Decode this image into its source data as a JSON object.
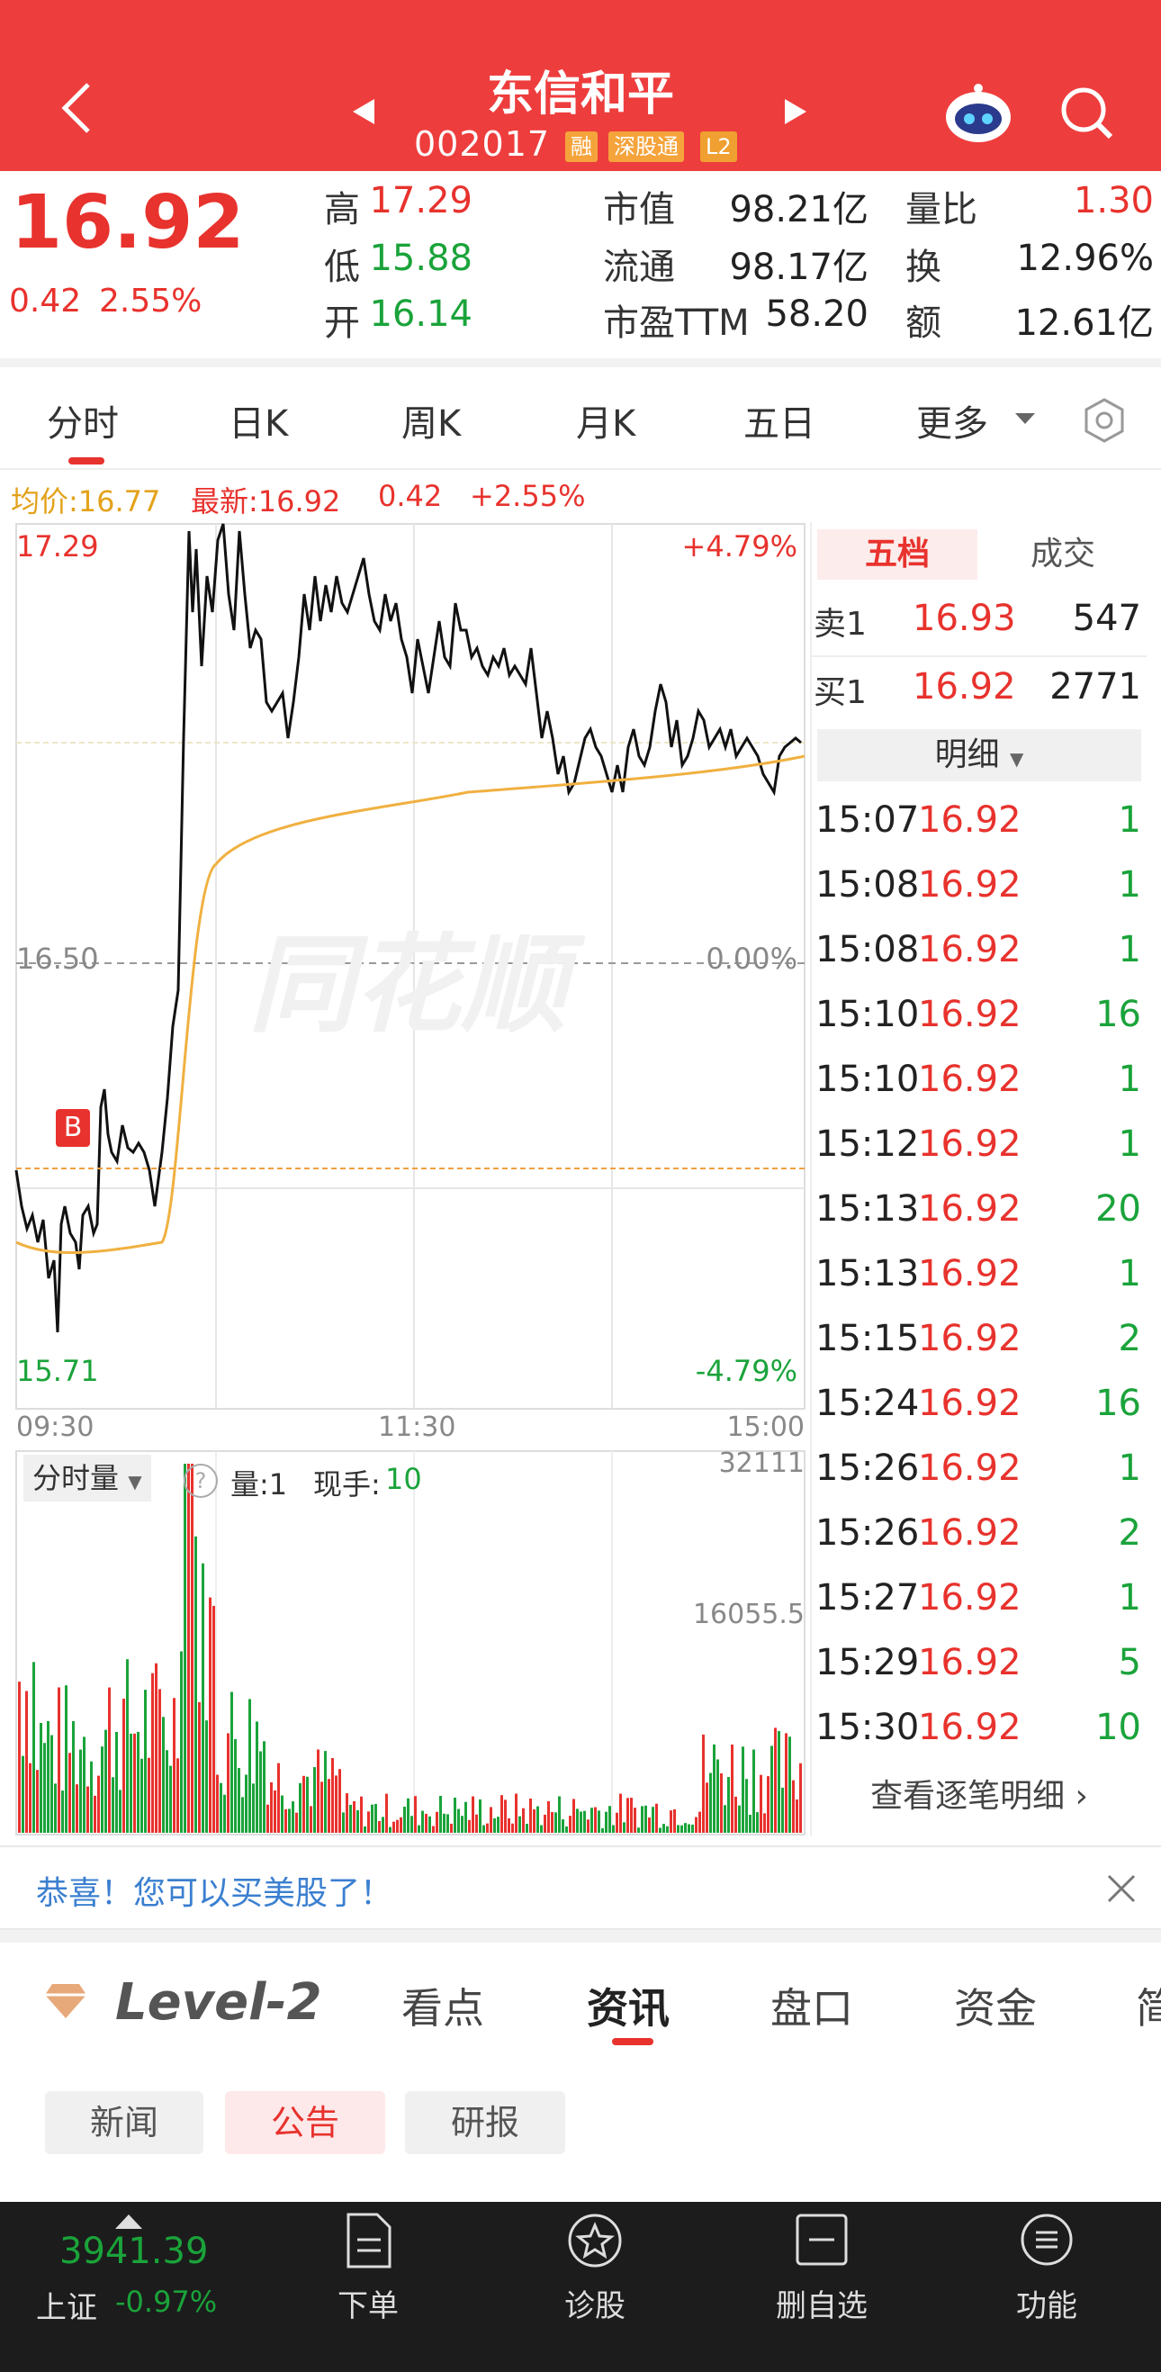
{
  "header": {
    "stock_name": "东信和平",
    "stock_code": "002017",
    "tags": [
      "融",
      "深股通",
      "L2"
    ]
  },
  "quote": {
    "price": "16.92",
    "change": "0.42",
    "change_pct": "2.55%",
    "stats": [
      [
        {
          "label": "高",
          "value": "17.29",
          "color": "red"
        },
        {
          "label": "市值",
          "value": "98.21亿",
          "color": "dark"
        },
        {
          "label": "量比",
          "value": "1.30",
          "color": "red"
        }
      ],
      [
        {
          "label": "低",
          "value": "15.88",
          "color": "green"
        },
        {
          "label": "流通",
          "value": "98.17亿",
          "color": "dark"
        },
        {
          "label": "换",
          "value": "12.96%",
          "color": "dark"
        }
      ],
      [
        {
          "label": "开",
          "value": "16.14",
          "color": "green"
        },
        {
          "label": "市盈TTM",
          "value": "58.20",
          "color": "dark"
        },
        {
          "label": "额",
          "value": "12.61亿",
          "color": "dark"
        }
      ]
    ]
  },
  "chart_tabs": [
    "分时",
    "日K",
    "周K",
    "月K",
    "五日",
    "更多"
  ],
  "info_line": {
    "avg_label": "均价:16.77",
    "latest_label": "最新:16.92",
    "change": "0.42",
    "change_pct": "+2.55%"
  },
  "price_chart": {
    "y_top_label": "17.29",
    "y_mid_label": "16.50",
    "y_bottom_label": "15.71",
    "pct_top_label": "+4.79%",
    "pct_mid_label": "0.00%",
    "pct_bottom_label": "-4.79%",
    "x_labels": [
      "09:30",
      "11:30",
      "15:00"
    ],
    "marker_label": "B",
    "watermark": "同花顺"
  },
  "volume_panel": {
    "selector_label": "分时量",
    "help_glyph": "?",
    "qty_label": "量:1",
    "hand_label": "现手:",
    "hand_value": "10",
    "max_label": "32111",
    "mid_label": "16055.5"
  },
  "order_book": {
    "tab_active": "五档",
    "tab_other": "成交",
    "sell": {
      "label": "卖1",
      "price": "16.93",
      "qty": "547"
    },
    "buy": {
      "label": "买1",
      "price": "16.92",
      "qty": "2771"
    },
    "detail_label": "明细",
    "trades": [
      {
        "time": "15:07",
        "price": "16.92",
        "qty": "1"
      },
      {
        "time": "15:08",
        "price": "16.92",
        "qty": "1"
      },
      {
        "time": "15:08",
        "price": "16.92",
        "qty": "1"
      },
      {
        "time": "15:10",
        "price": "16.92",
        "qty": "16"
      },
      {
        "time": "15:10",
        "price": "16.92",
        "qty": "1"
      },
      {
        "time": "15:12",
        "price": "16.92",
        "qty": "1"
      },
      {
        "time": "15:13",
        "price": "16.92",
        "qty": "20"
      },
      {
        "time": "15:13",
        "price": "16.92",
        "qty": "1"
      },
      {
        "time": "15:15",
        "price": "16.92",
        "qty": "2"
      },
      {
        "time": "15:24",
        "price": "16.92",
        "qty": "16"
      },
      {
        "time": "15:26",
        "price": "16.92",
        "qty": "1"
      },
      {
        "time": "15:26",
        "price": "16.92",
        "qty": "2"
      },
      {
        "time": "15:27",
        "price": "16.92",
        "qty": "1"
      },
      {
        "time": "15:29",
        "price": "16.92",
        "qty": "5"
      },
      {
        "time": "15:30",
        "price": "16.92",
        "qty": "10"
      }
    ],
    "view_all_label": "查看逐笔明细"
  },
  "banner": {
    "text": "恭喜！您可以买美股了！"
  },
  "news_tabs": {
    "level2_label": "Level-2",
    "tabs": [
      "看点",
      "资讯",
      "盘口",
      "资金",
      "简"
    ],
    "active_index": 1
  },
  "sub_tabs": {
    "items": [
      "新闻",
      "公告",
      "研报"
    ],
    "active_index": 1
  },
  "bottom_bar": {
    "index_value": "3941.39",
    "index_name": "上证",
    "index_change": "-0.97%",
    "items": [
      {
        "label": "下单",
        "icon": "document-icon"
      },
      {
        "label": "诊股",
        "icon": "star-badge-icon"
      },
      {
        "label": "删自选",
        "icon": "minus-box-icon"
      },
      {
        "label": "功能",
        "icon": "menu-circle-icon"
      }
    ]
  },
  "colors": {
    "brand_red": "#ee3d3d",
    "up_red": "#e8322d",
    "down_green": "#1aa33a",
    "avg_line": "#f0b040"
  }
}
